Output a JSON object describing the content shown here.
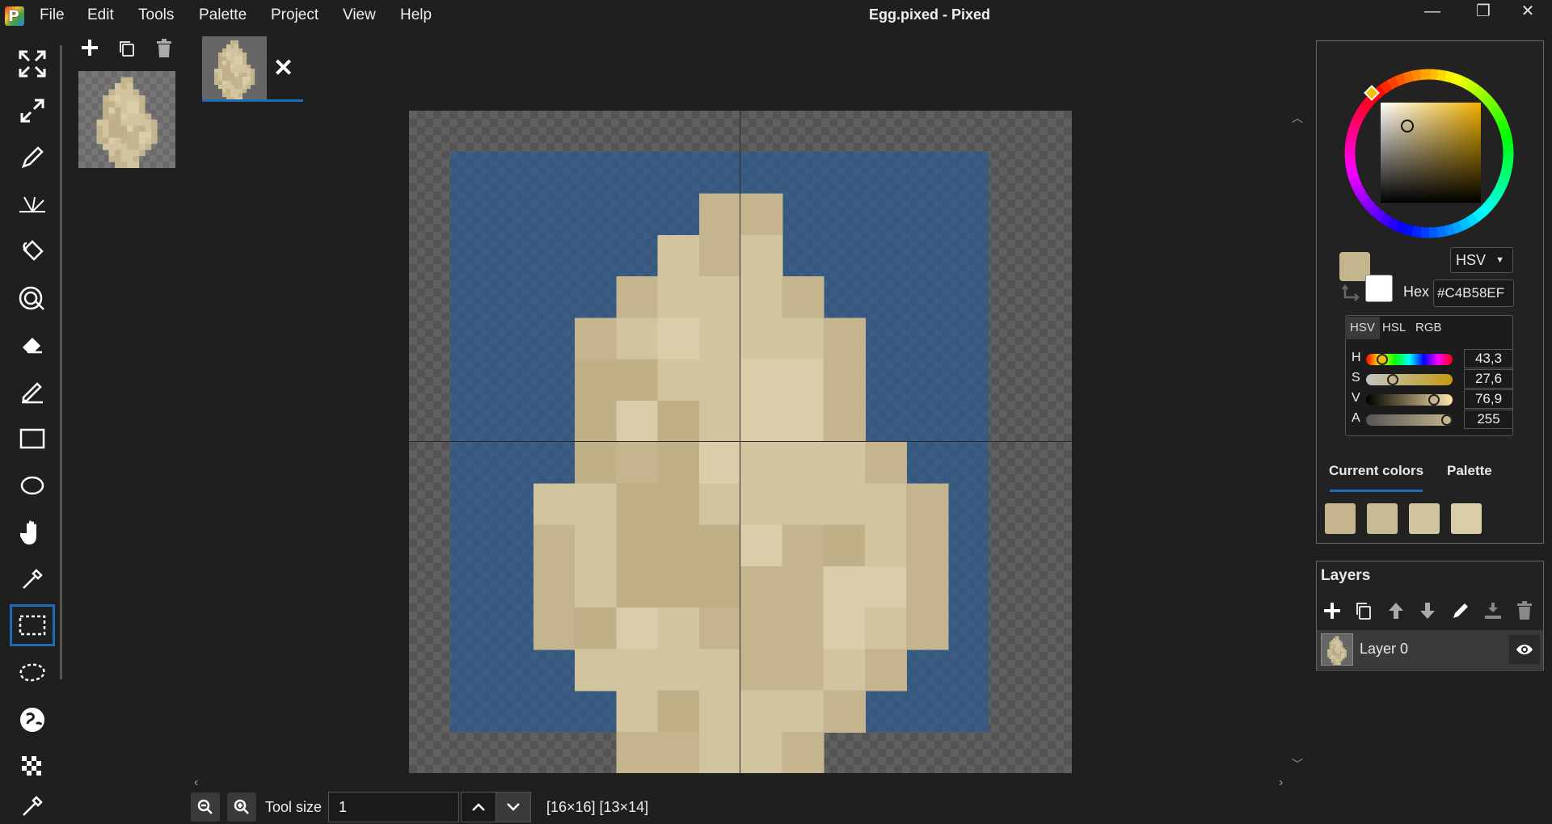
{
  "window": {
    "title": "Egg.pixed - Pixed",
    "logo_letter": "P",
    "controls": [
      "—",
      "❐",
      "✕"
    ]
  },
  "menu": [
    "File",
    "Edit",
    "Tools",
    "Palette",
    "Project",
    "View",
    "Help"
  ],
  "tools": [
    "fit-screen",
    "expand",
    "pencil",
    "line",
    "bucket",
    "spray",
    "eraser",
    "brush",
    "rectangle",
    "ellipse",
    "hand",
    "color-picker",
    "rectangle-select",
    "lasso-select",
    "globe",
    "checker",
    "dropper"
  ],
  "selected_tool": "rectangle-select",
  "frames": {
    "actions": [
      "add",
      "duplicate",
      "delete"
    ]
  },
  "document_tab": {
    "close_glyph": "✕"
  },
  "bottom": {
    "tool_size_label": "Tool size",
    "tool_size_value": "1",
    "status": "[16×16] [13×14]"
  },
  "color": {
    "primary": "#C4B58E",
    "secondary": "#FFFFFF",
    "mode_select": "HSV",
    "hex_label": "Hex",
    "hex_value": "#C4B58EF",
    "modes": [
      "HSV",
      "HSL",
      "RGB"
    ],
    "sliders": [
      {
        "label": "H",
        "value": "43,3"
      },
      {
        "label": "S",
        "value": "27,6"
      },
      {
        "label": "V",
        "value": "76,9"
      },
      {
        "label": "A",
        "value": "255"
      }
    ],
    "tabs": [
      "Current colors",
      "Palette"
    ],
    "current_colors": [
      "#C4B58E",
      "#C8BA95",
      "#D2C49E",
      "#D9CCA6"
    ]
  },
  "layers": {
    "title": "Layers",
    "actions": [
      "add",
      "duplicate",
      "move-up",
      "move-down",
      "rename",
      "merge-down",
      "delete"
    ],
    "items": [
      {
        "name": "Layer 0",
        "visible": true
      }
    ]
  },
  "egg": {
    "cell_colors": {
      "a": "#C4B58E",
      "b": "#D2C49E",
      "c": "#DACDA9",
      "d": "#BFB088"
    },
    "rows": [
      "......aa......",
      ".....bab......",
      "....abbba.....",
      "...abcbbba....",
      "...ddbbcca....",
      "...dcdbcca....",
      "...dadcbbba...",
      "..bbddbbbbba..",
      "..abdddcadba..",
      "..abdddaacca..",
      "..adcbaaacba..",
      "...bbbbaaba...",
      "....bdbbba....",
      "....aabba.....",
      ".....aabb....."
    ]
  }
}
